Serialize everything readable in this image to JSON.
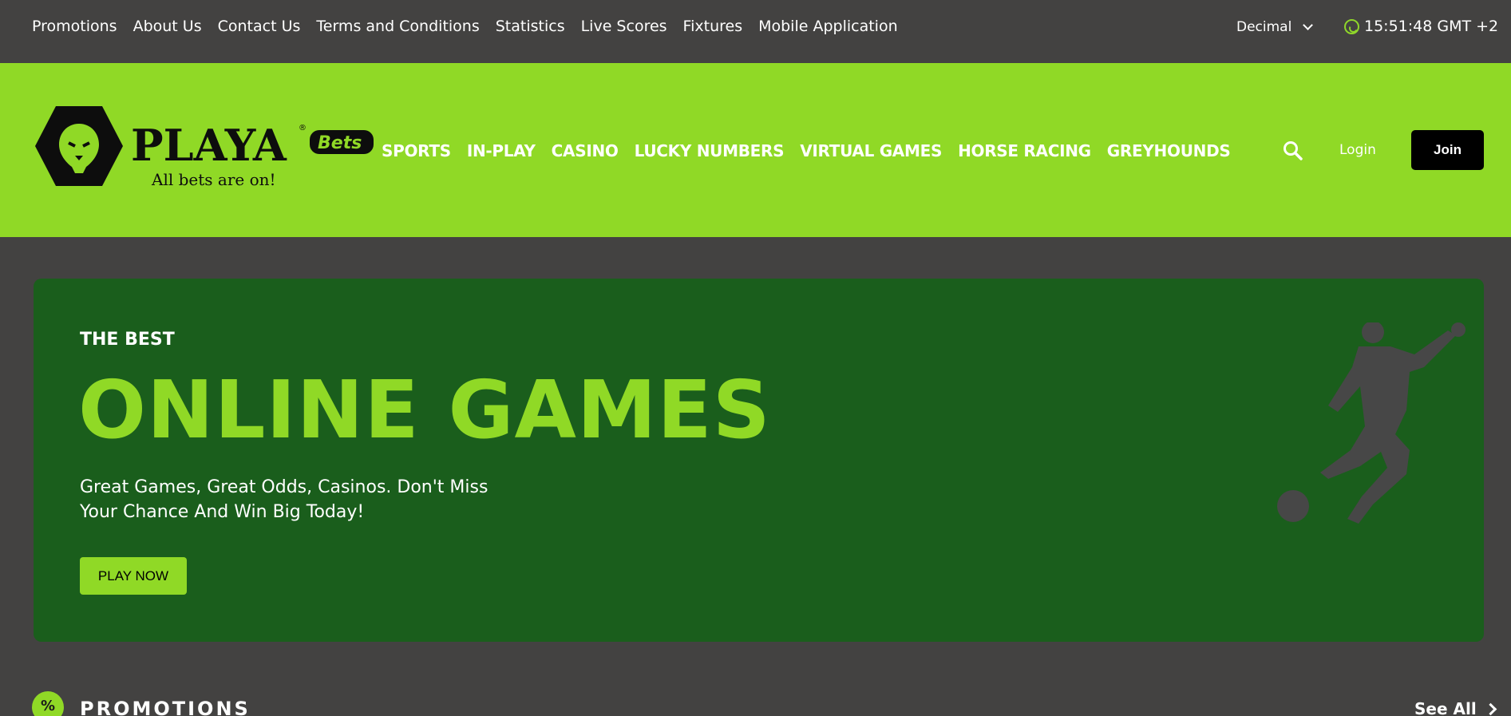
{
  "topbar": {
    "links": [
      "Promotions",
      "About Us",
      "Contact Us",
      "Terms and Conditions",
      "Statistics",
      "Live Scores",
      "Fixtures",
      "Mobile Application"
    ],
    "odds_format": "Decimal",
    "clock": "15:51:48 GMT +2"
  },
  "header": {
    "brand": "PLAYA",
    "brand_badge": "Bets",
    "tagline": "All bets are on!",
    "nav": [
      "SPORTS",
      "IN-PLAY",
      "CASINO",
      "LUCKY NUMBERS",
      "VIRTUAL GAMES",
      "HORSE RACING",
      "GREYHOUNDS"
    ],
    "login_label": "Login",
    "join_label": "Join"
  },
  "hero": {
    "kicker": "THE BEST",
    "headline": "ONLINE GAMES",
    "description": "Great Games, Great Odds, Casinos. Don't Miss Your Chance And Win Big Today!",
    "cta_label": "PLAY NOW"
  },
  "promotions": {
    "icon_glyph": "%",
    "title": "PROMOTIONS",
    "see_all_label": "See All"
  },
  "icons": {
    "whatsapp": "whatsapp-icon",
    "search": "search-icon",
    "dropdown": "chevron-down-icon",
    "arrow": "chevron-right-icon",
    "logo": "lion-logo-icon",
    "player": "football-player-icon"
  },
  "colors": {
    "accent": "#90d926",
    "hero_bg": "#1a5e1c",
    "page_bg": "#434241"
  }
}
